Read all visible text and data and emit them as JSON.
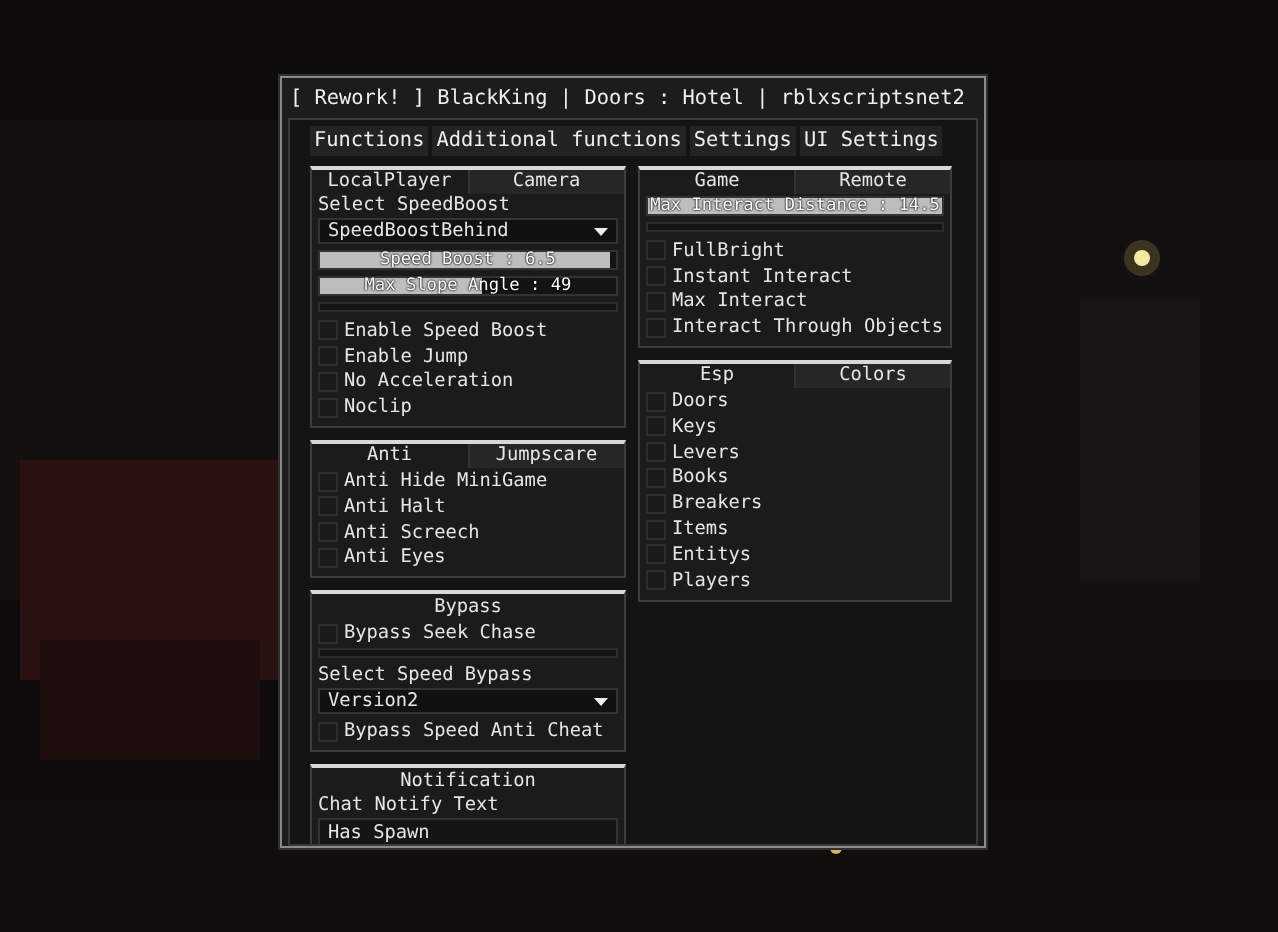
{
  "window": {
    "title": "[ Rework! ] BlackKing | Doors : Hotel | rblxscriptsnet2"
  },
  "main_tabs": [
    "Functions",
    "Additional functions",
    "Settings",
    "UI Settings"
  ],
  "columns": [
    {
      "sections": [
        {
          "tabs": [
            {
              "label": "LocalPlayer",
              "selected": true
            },
            {
              "label": "Camera",
              "selected": false
            }
          ],
          "items": [
            {
              "kind": "label",
              "text": "Select SpeedBoost"
            },
            {
              "kind": "dropdown",
              "value": "SpeedBoostBehind"
            },
            {
              "kind": "slider",
              "label": "Speed Boost : 6.5",
              "level": 0.98
            },
            {
              "kind": "slider",
              "label": "Max Slope Angle : 49",
              "level": 0.55
            },
            {
              "kind": "divider"
            },
            {
              "kind": "checkbox",
              "label": "Enable Speed Boost",
              "checked": false
            },
            {
              "kind": "checkbox",
              "label": "Enable Jump",
              "checked": false
            },
            {
              "kind": "checkbox",
              "label": "No Acceleration",
              "checked": false
            },
            {
              "kind": "checkbox",
              "label": "Noclip",
              "checked": false
            }
          ]
        },
        {
          "tabs": [
            {
              "label": "Anti",
              "selected": true
            },
            {
              "label": "Jumpscare",
              "selected": false
            }
          ],
          "items": [
            {
              "kind": "checkbox",
              "label": "Anti Hide MiniGame",
              "checked": false
            },
            {
              "kind": "checkbox",
              "label": "Anti Halt",
              "checked": false
            },
            {
              "kind": "checkbox",
              "label": "Anti Screech",
              "checked": false
            },
            {
              "kind": "checkbox",
              "label": "Anti Eyes",
              "checked": false
            }
          ]
        },
        {
          "header": "Bypass",
          "items": [
            {
              "kind": "checkbox",
              "label": "Bypass Seek Chase",
              "checked": false
            },
            {
              "kind": "divider"
            },
            {
              "kind": "label",
              "text": "Select Speed Bypass"
            },
            {
              "kind": "dropdown",
              "value": "Version2"
            },
            {
              "kind": "checkbox",
              "label": "Bypass Speed Anti Cheat",
              "checked": false
            }
          ]
        },
        {
          "header": "Notification",
          "items": [
            {
              "kind": "label",
              "text": "Chat Notify Text"
            },
            {
              "kind": "textbox",
              "value": "Has Spawn"
            }
          ]
        }
      ]
    },
    {
      "sections": [
        {
          "tabs": [
            {
              "label": "Game",
              "selected": true
            },
            {
              "label": "Remote",
              "selected": false
            }
          ],
          "items": [
            {
              "kind": "slider",
              "label": "Max Interact Distance : 14.5",
              "level": 1
            },
            {
              "kind": "divider"
            },
            {
              "kind": "checkbox",
              "label": "FullBright",
              "checked": false
            },
            {
              "kind": "checkbox",
              "label": "Instant Interact",
              "checked": false
            },
            {
              "kind": "checkbox",
              "label": "Max Interact",
              "checked": false
            },
            {
              "kind": "checkbox",
              "label": "Interact Through Objects",
              "checked": false
            }
          ]
        },
        {
          "tabs": [
            {
              "label": "Esp",
              "selected": true
            },
            {
              "label": "Colors",
              "selected": false
            }
          ],
          "items": [
            {
              "kind": "checkbox",
              "label": "Doors",
              "checked": false
            },
            {
              "kind": "checkbox",
              "label": "Keys",
              "checked": false
            },
            {
              "kind": "checkbox",
              "label": "Levers",
              "checked": false
            },
            {
              "kind": "checkbox",
              "label": "Books",
              "checked": false
            },
            {
              "kind": "checkbox",
              "label": "Breakers",
              "checked": false
            },
            {
              "kind": "checkbox",
              "label": "Items",
              "checked": false
            },
            {
              "kind": "checkbox",
              "label": "Entitys",
              "checked": false
            },
            {
              "kind": "checkbox",
              "label": "Players",
              "checked": false
            }
          ]
        }
      ]
    }
  ]
}
